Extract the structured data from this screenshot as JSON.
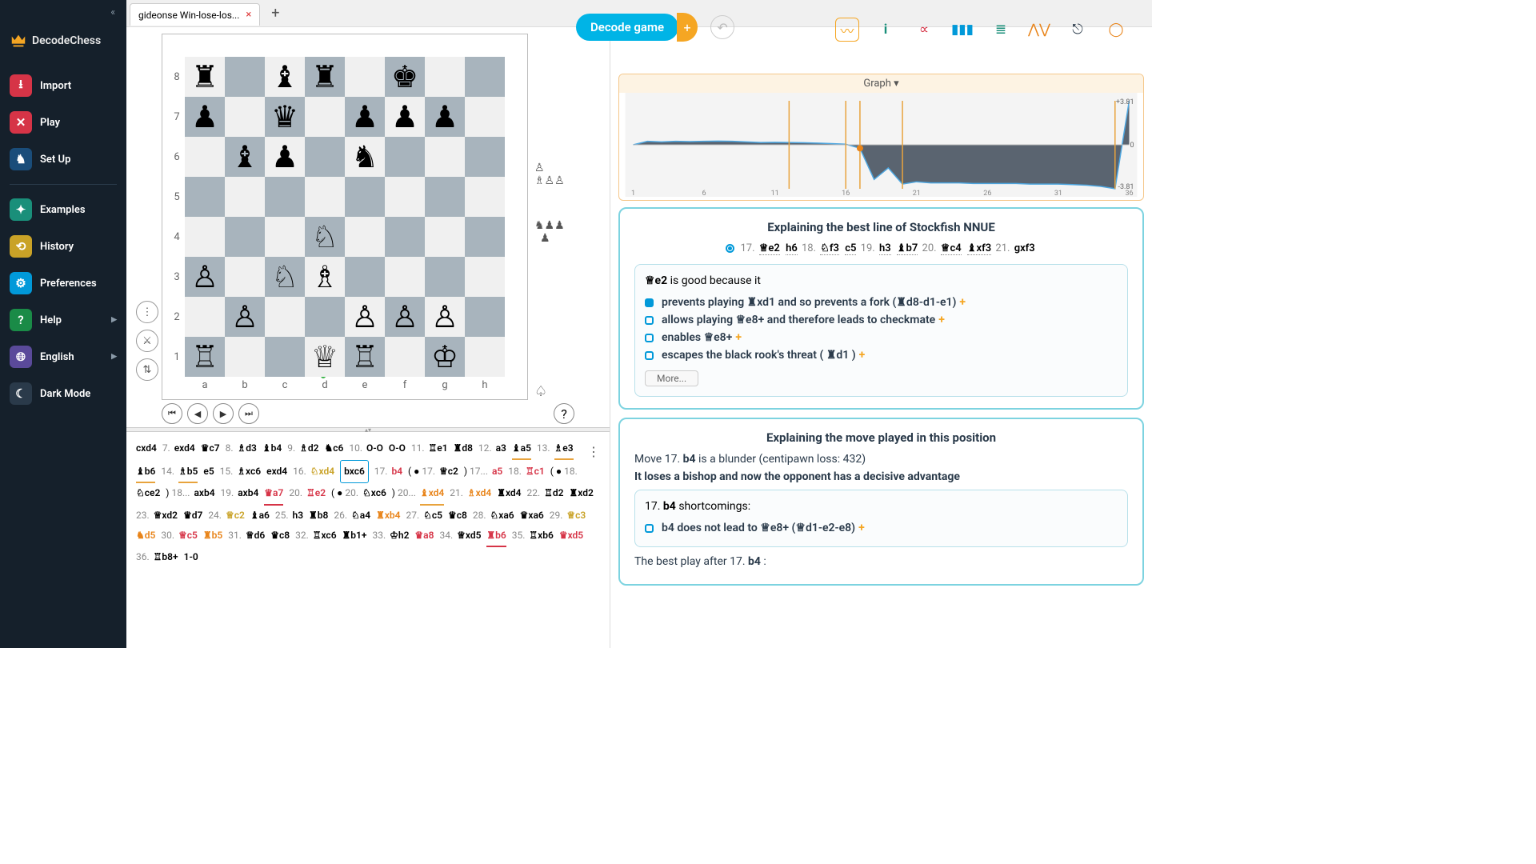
{
  "brand": "DecodeChess",
  "sidebar": {
    "items": [
      {
        "label": "Import"
      },
      {
        "label": "Play"
      },
      {
        "label": "Set Up"
      },
      {
        "label": "Examples"
      },
      {
        "label": "History"
      },
      {
        "label": "Preferences"
      },
      {
        "label": "Help"
      },
      {
        "label": "English"
      },
      {
        "label": "Dark Mode"
      }
    ]
  },
  "tab": {
    "title": "gideonse Win-lose-los...",
    "add": "+"
  },
  "decode_label": "Decode game",
  "board": {
    "ranks": [
      "8",
      "7",
      "6",
      "5",
      "4",
      "3",
      "2",
      "1"
    ],
    "files": [
      "a",
      "b",
      "c",
      "d",
      "e",
      "f",
      "g",
      "h"
    ],
    "position": {
      "a8": "♜",
      "c8": "♝",
      "d8": "♜",
      "f8": "♚",
      "a7": "♟",
      "c7": "♛",
      "e7": "♟",
      "f7": "♟",
      "g7": "♟",
      "b6": "♝",
      "c6": "♟",
      "e6": "♞",
      "d4": "♘",
      "a3": "♙",
      "c3": "♘",
      "d3": "♗",
      "b2": "♙",
      "e2": "♙",
      "f2": "♙",
      "g2": "♙",
      "a1": "♖",
      "d1": "♕",
      "e1": "♖",
      "g1": "♔"
    }
  },
  "chart_data": {
    "type": "area",
    "title": "Graph ▾",
    "xlabel": "",
    "ylabel": "",
    "x_ticks": [
      1,
      6,
      11,
      16,
      21,
      26,
      31,
      36
    ],
    "ylim": [
      -3.81,
      3.81
    ],
    "right_labels": [
      "+3.81",
      "0",
      "-3.81"
    ],
    "markers": [
      12,
      16,
      17,
      20,
      35
    ],
    "current": 17,
    "values": [
      0.3,
      0.3,
      0.25,
      0.3,
      0.28,
      0.3,
      0.32,
      0.3,
      0.25,
      0.2,
      0.22,
      0.2,
      0.18,
      0.15,
      0.1,
      0.05,
      -0.3,
      -3.0,
      -2.0,
      -3.4,
      -3.2,
      -3.3,
      -3.3,
      -3.3,
      -3.35,
      -3.35,
      -3.35,
      -3.35,
      -3.4,
      -3.4,
      -3.4,
      -3.45,
      -3.5,
      -3.6,
      -3.8,
      3.81
    ]
  },
  "best": {
    "title": "Explaining the best line of Stockfish NNUE",
    "line": [
      {
        "n": "17.",
        "m": "♕e2",
        "dot": true
      },
      {
        "m": "h6",
        "dot": true
      },
      {
        "n": "18.",
        "m": "♘f3",
        "dot": true
      },
      {
        "m": "c5",
        "dot": true
      },
      {
        "n": "19.",
        "m": "h3",
        "dot": true
      },
      {
        "m": "♝b7",
        "dot": true
      },
      {
        "n": "20.",
        "m": "♕c4",
        "dot": true
      },
      {
        "m": "♝xf3",
        "dot": true
      },
      {
        "n": "21.",
        "m": "gxf3"
      }
    ],
    "reason_head_move": "♕e2",
    "reason_head_tail": " is good because it",
    "reasons": [
      "prevents playing ♜xd1  and so prevents a fork (♜d8-d1-e1)",
      "allows playing ♕e8+  and therefore leads to checkmate",
      "enables ♕e8+",
      "escapes the black rook's threat ( ♜d1 )"
    ],
    "more": "More..."
  },
  "played": {
    "title": "Explaining the move played in this position",
    "l1_a": "Move ",
    "l1_n": "17.",
    "l1_m": "b4",
    "l1_b": " is a blunder (centipawn loss: 432)",
    "l2": "It loses a bishop and now the opponent has a decisive advantage",
    "sc_n": "17.",
    "sc_m": "b4",
    "sc_t": " shortcomings:",
    "sc_item": "b4  does not lead to ♕e8+ (♕d1-e2-e8)",
    "best_after_a": "The best play after ",
    "best_after_n": "17.",
    "best_after_m": "b4",
    "best_after_c": " :"
  },
  "moves_html": "<span class='mv'>cxd4</span> <span class='mn'>7.</span> <span class='mv'>exd4</span> <span class='mv'>♛c7</span> <span class='mn'>8.</span> <span class='mv'>♗d3</span> <span class='mv'>♝b4</span> <span class='mn'>9.</span> <span class='mv'>♗d2</span> <span class='mv'>♞c6</span> <span class='mn'>10.</span> <span class='mv'>O-O</span> <span class='mv'>O-O</span> <span class='mn'>11.</span> <span class='mv'>♖e1</span> <span class='mv'>♜d8</span> <span class='mn'>12.</span> <span class='mv'>a3</span> <span class='mv u-orange'>♝a5</span> <span class='mn'>13.</span> <span class='mv u-orange'>♗e3</span> <span class='mv u-orange'>♝b6</span> <span class='mn'>14.</span> <span class='mv u-orange'>♗b5</span> <span class='mv'>e5</span> <span class='mn'>15.</span> <span class='mv'>♗xc6</span> <span class='mv'>exd4</span> <span class='mn'>16.</span> <span class='mv c-amber'>♘xd4</span> <span class='mv hl'>bxc6</span> <span class='mn'>17.</span> <span class='mv c-red'>b4</span> ( ● <span class='mn'>17.</span> <span class='mv'>♕c2</span> ) <span class='mn'>17...</span> <span class='mv c-red'>a5</span> <span class='mn'>18.</span> <span class='mv c-red'>♖c1</span> ( ● <span class='mn'>18.</span> <span class='mv'>♘ce2</span> ) <span class='mn'>18...</span> <span class='mv'>axb4</span> <span class='mn'>19.</span> <span class='mv'>axb4</span> <span class='mv c-red u-red'>♛a7</span> <span class='mn'>20.</span> <span class='mv c-red'>♖e2</span> ( ● <span class='mn'>20.</span> <span class='mv'>♘xc6</span> ) <span class='mn'>20...</span> <span class='mv c-orange u-orange'>♝xd4</span> <span class='mn'>21.</span> <span class='mv c-orange'>♗xd4</span> <span class='mv'>♜xd4</span> <span class='mn'>22.</span> <span class='mv'>♖d2</span> <span class='mv'>♜xd2</span> <span class='mn'>23.</span> <span class='mv'>♕xd2</span> <span class='mv'>♛d7</span> <span class='mn'>24.</span> <span class='mv c-amber'>♕c2</span> <span class='mv'>♝a6</span> <span class='mn'>25.</span> <span class='mv'>h3</span> <span class='mv'>♜b8</span> <span class='mn'>26.</span> <span class='mv'>♘a4</span> <span class='mv c-orange'>♜xb4</span> <span class='mn'>27.</span> <span class='mv'>♘c5</span> <span class='mv'>♛c8</span> <span class='mn'>28.</span> <span class='mv'>♘xa6</span> <span class='mv'>♛xa6</span> <span class='mn'>29.</span> <span class='mv c-amber'>♕c3</span> <span class='mv c-orange'>♞d5</span> <span class='mn'>30.</span> <span class='mv c-red'>♕c5</span> <span class='mv c-orange'>♜b5</span> <span class='mn'>31.</span> <span class='mv'>♕d6</span> <span class='mv'>♛c8</span> <span class='mn'>32.</span> <span class='mv'>♖xc6</span> <span class='mv'>♜b1+</span> <span class='mn'>33.</span> <span class='mv'>♔h2</span> <span class='mv c-red'>♛a8</span> <span class='mn'>34.</span> <span class='mv'>♕xd5</span> <span class='mv c-red u-red'>♜b6</span> <span class='mn'>35.</span> <span class='mv'>♖xb6</span> <span class='mv c-red'>♛xd5</span> <span class='mn'>36.</span> <span class='mv'>♖b8+</span> <span class='mv'>1-0</span>"
}
